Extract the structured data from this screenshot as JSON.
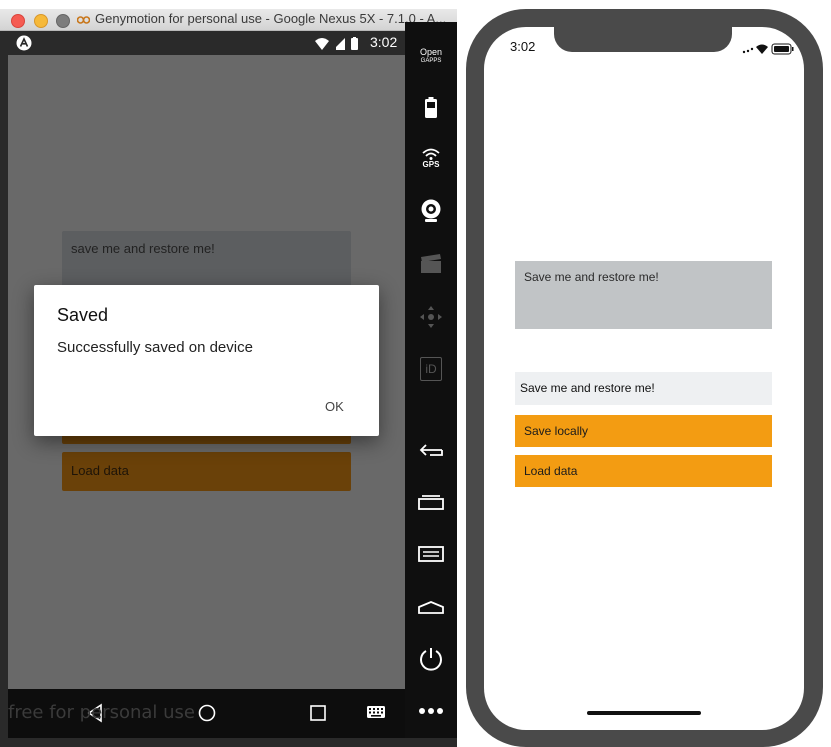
{
  "genymotion": {
    "window_title": "Genymotion for personal use - Google Nexus 5X - 7.1.0 - A...",
    "traffic_lights": [
      "#f55b52",
      "#f6b93a",
      "#7d7d7d"
    ],
    "watermark": "free for personal use",
    "toolbar": [
      {
        "icon": "open-gapps-icon",
        "label_top": "Open",
        "label_bottom": "GAPPS"
      },
      {
        "icon": "battery-icon"
      },
      {
        "icon": "gps-icon",
        "label": "GPS"
      },
      {
        "icon": "webcam-icon"
      },
      {
        "icon": "clapperboard-icon"
      },
      {
        "icon": "dpad-icon"
      },
      {
        "icon": "identifier-icon",
        "label": "iD"
      },
      {
        "icon": "back-icon"
      },
      {
        "icon": "recent-apps-icon"
      },
      {
        "icon": "menu-icon"
      },
      {
        "icon": "home-icon"
      },
      {
        "icon": "power-icon"
      },
      {
        "icon": "more-icon"
      }
    ]
  },
  "android": {
    "status_time": "3:02",
    "input_text": "save me and restore me!",
    "load_button": "Load data",
    "dialog": {
      "title": "Saved",
      "message": "Successfully saved on device",
      "ok_button": "OK"
    },
    "navbar": [
      "back-icon",
      "home-icon",
      "recents-icon",
      "keyboard-icon"
    ]
  },
  "ios": {
    "status_time": "3:02",
    "textarea_text": "Save me and restore me!",
    "display_text": "Save me and restore me!",
    "save_button": "Save locally",
    "load_button": "Load data",
    "accent_color": "#f39c12"
  }
}
